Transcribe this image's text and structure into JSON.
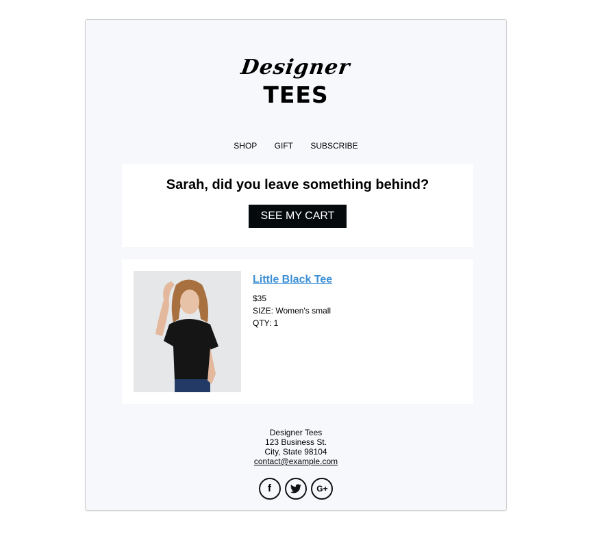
{
  "brand": {
    "script": "Designer",
    "block": "TEES"
  },
  "nav": [
    {
      "label": "SHOP"
    },
    {
      "label": "GIFT"
    },
    {
      "label": "SUBSCRIBE"
    }
  ],
  "hero": {
    "heading": "Sarah, did you leave something behind?",
    "cta_label": "SEE MY CART"
  },
  "product": {
    "name": "Little Black Tee",
    "price": "$35",
    "size": "SIZE: Women's small",
    "qty": "QTY: 1",
    "image_alt": "Woman wearing a black tee"
  },
  "footer": {
    "company": "Designer Tees",
    "street": "123 Business St.",
    "city": "City, State 98104",
    "email": "contact@example.com"
  },
  "social": [
    {
      "icon": "facebook-icon",
      "glyph": "f"
    },
    {
      "icon": "twitter-icon",
      "glyph": "t"
    },
    {
      "icon": "google-plus-icon",
      "glyph": "G+"
    }
  ],
  "colors": {
    "link": "#3b8fd4",
    "cta_bg": "#050a0c",
    "canvas": "#f7f8fc"
  }
}
